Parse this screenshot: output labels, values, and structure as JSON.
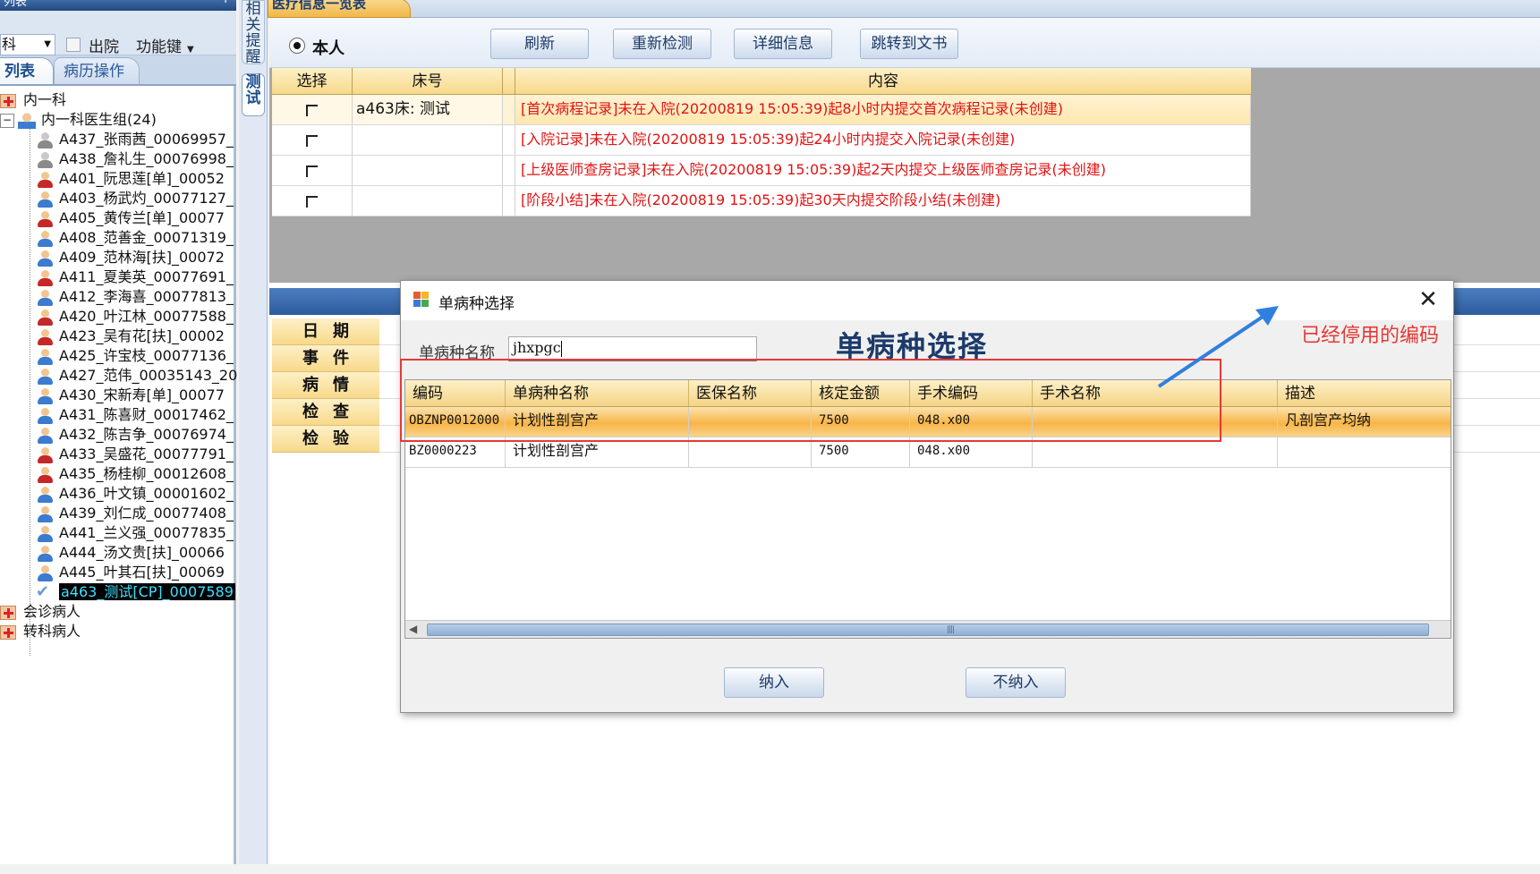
{
  "left_panel": {
    "title": "列表",
    "dept_value": "科",
    "discharge_label": "出院",
    "func_key_label": "功能键",
    "tabs": [
      "列表",
      "病历操作"
    ],
    "tree": {
      "dept": "内一科",
      "group": "内一科医生组(24)",
      "patients": [
        "A437_张雨茜_00069957_",
        "A438_詹礼生_00076998_",
        "A401_阮思莲[单]_00052",
        "A403_杨武灼_00077127_",
        "A405_黄传兰[单]_00077",
        "A408_范善金_00071319_",
        "A409_范林海[扶]_00072",
        "A411_夏美英_00077691_",
        "A412_李海喜_00077813_",
        "A420_叶江林_00077588_",
        "A423_吴有花[扶]_00002",
        "A425_许宝枝_00077136_",
        "A427_范伟_00035143_20",
        "A430_宋新寿[单]_00077",
        "A431_陈喜财_00017462_",
        "A432_陈吉争_00076974_",
        "A433_吴盛花_00077791_",
        "A435_杨桂柳_00012608_",
        "A436_叶文镇_00001602_",
        "A439_刘仁成_00077408_",
        "A441_兰义强_00077835_",
        "A444_汤文贵[扶]_00066",
        "A445_叶其石[扶]_00069",
        "a463_测试[CP]_0007589"
      ],
      "consult": "会诊病人",
      "transfer": "转科病人"
    }
  },
  "side_tabs": {
    "reminder": "相关提醒",
    "test": "测试"
  },
  "main": {
    "tab_label": "医疗信息一览表",
    "radio_self": "本人",
    "buttons": [
      "刷新",
      "重新检测",
      "详细信息",
      "跳转到文书"
    ],
    "grid": {
      "headers": [
        "选择",
        "床号",
        "内容"
      ],
      "rows": [
        {
          "bed": "a463床: 测试",
          "content": "[首次病程记录]未在入院(20200819  15:05:39)起8小时内提交首次病程记录(未创建)"
        },
        {
          "bed": "",
          "content": "[入院记录]未在入院(20200819  15:05:39)起24小时内提交入院记录(未创建)"
        },
        {
          "bed": "",
          "content": "[上级医师查房记录]未在入院(20200819  15:05:39)起2天内提交上级医师查房记录(未创建)"
        },
        {
          "bed": "",
          "content": "[阶段小结]未在入院(20200819  15:05:39)起30天内提交阶段小结(未创建)"
        }
      ]
    },
    "lower_labels": [
      "日期",
      "事件",
      "病情",
      "检查",
      "检验"
    ]
  },
  "dialog": {
    "title": "单病种选择",
    "heading": "单病种选择",
    "search_label": "单病种名称",
    "search_value": "jhxpgc",
    "columns": [
      "编码",
      "单病种名称",
      "医保名称",
      "核定金额",
      "手术编码",
      "手术名称",
      "描述"
    ],
    "rows": [
      {
        "code": "OBZNP0012000",
        "name": "计划性剖宫产",
        "insurance": "",
        "amount": "7500",
        "op_code": "048.x00",
        "op_name": "",
        "desc": "凡剖宫产均纳"
      },
      {
        "code": "BZ0000223",
        "name": "计划性剖宫产",
        "insurance": "",
        "amount": "7500",
        "op_code": "048.x00",
        "op_name": "",
        "desc": ""
      }
    ],
    "buttons": [
      "纳入",
      "不纳入"
    ]
  },
  "annotation": {
    "text": "已经停用的编码",
    "color": "#e53935"
  }
}
